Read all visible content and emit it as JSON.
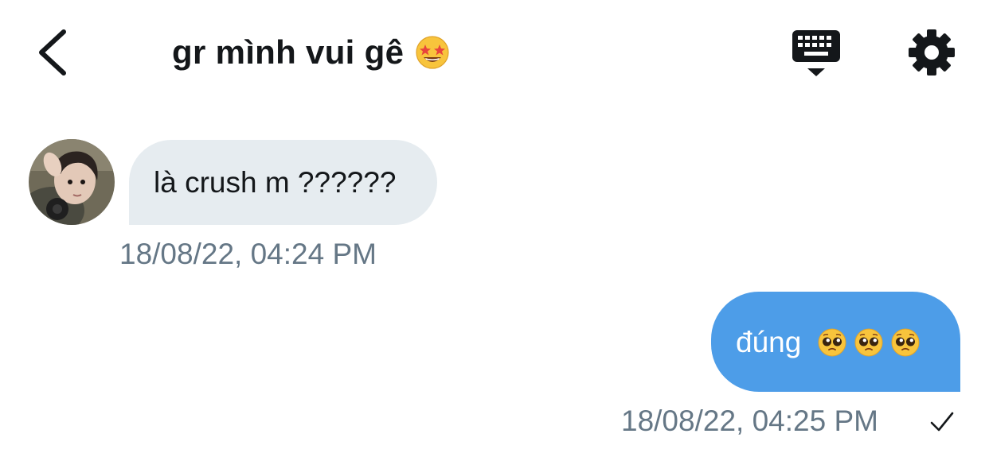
{
  "header": {
    "title": "gr mình vui gê",
    "title_emoji": "star-struck-emoji",
    "back_icon": "chevron-left-icon",
    "keyboard_icon": "keyboard-hide-icon",
    "settings_icon": "gear-icon"
  },
  "messages": [
    {
      "direction": "incoming",
      "text": "là crush m ??????",
      "timestamp": "18/08/22, 04:24 PM",
      "avatar": "sender-avatar"
    },
    {
      "direction": "outgoing",
      "text": "đúng",
      "emojis": [
        "pleading-face-emoji",
        "pleading-face-emoji",
        "pleading-face-emoji"
      ],
      "timestamp": "18/08/22, 04:25 PM",
      "status_icon": "check-icon"
    }
  ],
  "colors": {
    "incoming_bubble": "#e6ecf0",
    "outgoing_bubble": "#4d9de8",
    "timestamp": "#657786",
    "text": "#14171a"
  }
}
